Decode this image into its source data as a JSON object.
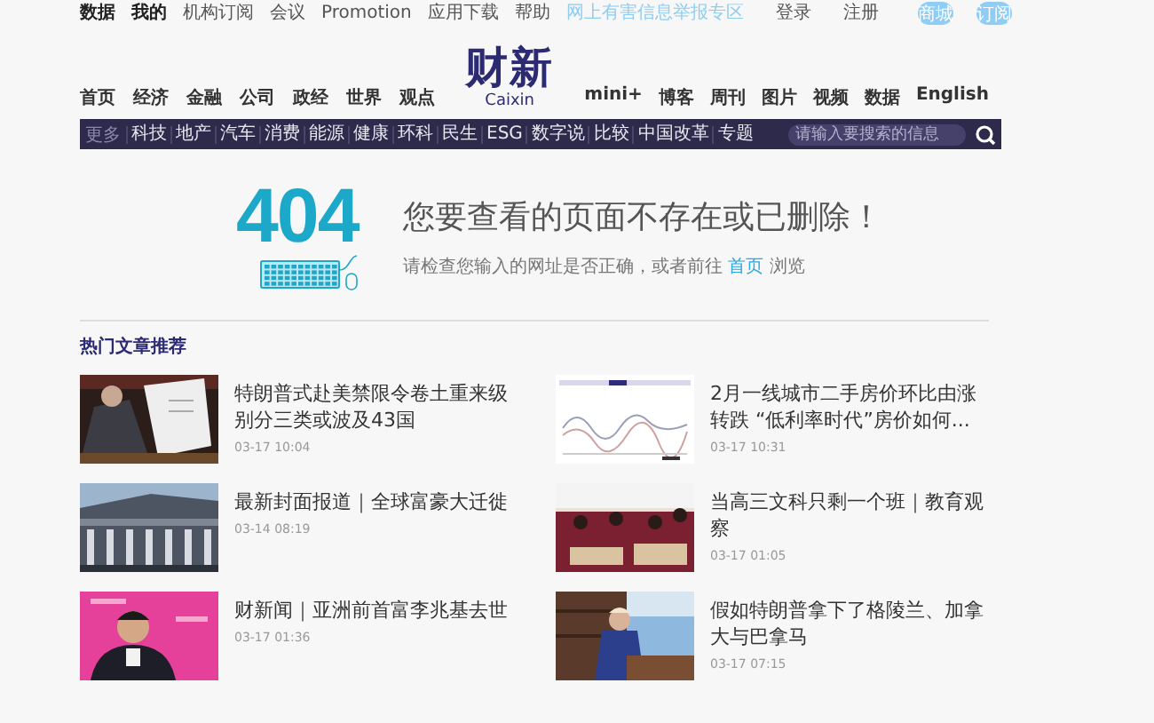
{
  "top_bar": {
    "links": [
      {
        "label": "数据",
        "bold": true
      },
      {
        "label": "我的",
        "bold": true
      },
      {
        "label": "机构订阅",
        "bold": false
      },
      {
        "label": "会议",
        "bold": false
      },
      {
        "label": "Promotion",
        "bold": false
      },
      {
        "label": "应用下载",
        "bold": false
      },
      {
        "label": "帮助",
        "bold": false
      }
    ],
    "report_link": "网上有害信息举报专区",
    "login": "登录",
    "register": "注册",
    "buttons": [
      "商城",
      "订阅"
    ]
  },
  "logo": {
    "title": "财新",
    "subtitle": "Caixin"
  },
  "main_nav_left": [
    "首页",
    "经济",
    "金融",
    "公司",
    "政经",
    "世界",
    "观点"
  ],
  "main_nav_right": [
    "mini+",
    "博客",
    "周刊",
    "图片",
    "视频",
    "数据",
    "English"
  ],
  "sub_nav": {
    "more": "更多",
    "items": [
      "科技",
      "地产",
      "汽车",
      "消费",
      "能源",
      "健康",
      "环科",
      "民生",
      "ESG",
      "数字说",
      "比较",
      "中国改革",
      "专题"
    ],
    "search": {
      "placeholder": "请输入要搜索的信息"
    }
  },
  "error": {
    "code": "404",
    "heading": "您要查看的页面不存在或已删除！",
    "hint_before": "请检查您输入的网址是否正确，或者前往",
    "hint_link": "首页",
    "hint_after": "浏览"
  },
  "hot": {
    "title": "热门文章推荐",
    "articles": [
      {
        "title": "特朗普式赴美禁限令卷土重来级别分三类或波及43国",
        "time": "03-17 10:04"
      },
      {
        "title": "2月一线城市二手房价环比由涨转跌 “低利率时代”房价如何...",
        "time": "03-17 10:31"
      },
      {
        "title": "最新封面报道｜全球富豪大迁徙",
        "time": "03-14 08:19"
      },
      {
        "title": "当高三文科只剩一个班｜教育观察",
        "time": "03-17 01:05"
      },
      {
        "title": "财新闻｜亚洲前首富李兆基去世",
        "time": "03-17 01:36"
      },
      {
        "title": "假如特朗普拿下了格陵兰、加拿大与巴拿马",
        "time": "03-17 07:15"
      }
    ]
  }
}
